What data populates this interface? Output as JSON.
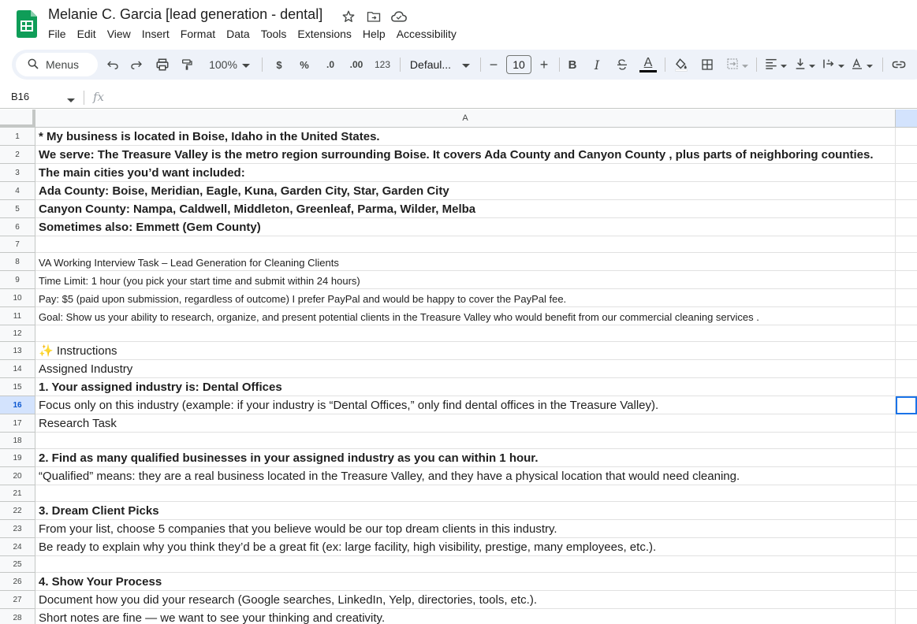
{
  "app": {
    "doc_title": "Melanie C. Garcia [lead generation - dental]",
    "menu": [
      "File",
      "Edit",
      "View",
      "Insert",
      "Format",
      "Data",
      "Tools",
      "Extensions",
      "Help",
      "Accessibility"
    ],
    "colors": {
      "sheets_green": "#0f9d58",
      "selection_blue": "#1a73e8",
      "header_sel": "#d3e3fd"
    }
  },
  "toolbar": {
    "search_label": "Menus",
    "zoom": "100%",
    "currency": "$",
    "percent": "%",
    "dec_decrease": ".0",
    "dec_increase": ".00",
    "number_format": "123",
    "font": "Defaul...",
    "font_size": "10",
    "minus": "−",
    "plus": "+",
    "bold": "B",
    "italic": "I",
    "text_color": "A"
  },
  "formula_bar": {
    "name_box": "B16",
    "fx": "fx"
  },
  "grid": {
    "column_header": "A",
    "rows": [
      {
        "n": "1",
        "text": "* My business is located in Boise, Idaho in the United States.",
        "style": "bold"
      },
      {
        "n": "2",
        "text": "We serve: The Treasure Valley is the metro region surrounding Boise. It covers Ada County and Canyon County , plus parts of neighboring counties.",
        "style": "bold"
      },
      {
        "n": "3",
        "text": "The main cities you’d want included:",
        "style": "bold"
      },
      {
        "n": "4",
        "text": "Ada County: Boise, Meridian, Eagle, Kuna, Garden City, Star, Garden City",
        "style": "bold"
      },
      {
        "n": "5",
        "text": "Canyon County: Nampa, Caldwell, Middleton, Greenleaf, Parma, Wilder, Melba",
        "style": "bold"
      },
      {
        "n": "6",
        "text": "Sometimes also: Emmett (Gem County)",
        "style": "bold"
      },
      {
        "n": "7",
        "text": "",
        "style": "short"
      },
      {
        "n": "8",
        "text": "VA Working Interview Task – Lead Generation for Cleaning Clients",
        "style": "small"
      },
      {
        "n": "9",
        "text": "Time Limit: 1 hour (you pick your start time and submit within 24 hours)",
        "style": "small"
      },
      {
        "n": "10",
        "text": "Pay: $5 (paid upon submission, regardless of outcome) I prefer PayPal and would be happy to cover the PayPal fee.",
        "style": "small"
      },
      {
        "n": "11",
        "text": "Goal: Show us your ability to research, organize, and present potential clients in the Treasure Valley who would benefit from our commercial cleaning services .",
        "style": "small"
      },
      {
        "n": "12",
        "text": "",
        "style": "short"
      },
      {
        "n": "13",
        "text": "✨ Instructions",
        "style": "normal"
      },
      {
        "n": "14",
        "text": "Assigned Industry",
        "style": "normal"
      },
      {
        "n": "15",
        "text": "1. Your assigned industry is: Dental Offices",
        "style": "bold"
      },
      {
        "n": "16",
        "text": "Focus only on this industry (example: if your industry is “Dental Offices,” only find dental offices in the Treasure Valley).",
        "style": "normal",
        "selected": true
      },
      {
        "n": "17",
        "text": "Research Task",
        "style": "normal"
      },
      {
        "n": "18",
        "text": "",
        "style": "short"
      },
      {
        "n": "19",
        "text": "2. Find as many qualified businesses in your assigned industry as you can within 1 hour.",
        "style": "bold"
      },
      {
        "n": "20",
        "text": "“Qualified” means: they are a real business located in the Treasure Valley, and they have a physical location that would need cleaning.",
        "style": "normal"
      },
      {
        "n": "21",
        "text": "",
        "style": "short"
      },
      {
        "n": "22",
        "text": "3. Dream Client Picks",
        "style": "bold"
      },
      {
        "n": "23",
        "text": "From your list, choose 5 companies that you believe would be our top dream clients in this industry.",
        "style": "normal"
      },
      {
        "n": "24",
        "text": "Be ready to explain why you think they’d be a great fit (ex: large facility, high visibility, prestige, many employees, etc.).",
        "style": "normal"
      },
      {
        "n": "25",
        "text": "",
        "style": "short"
      },
      {
        "n": "26",
        "text": "4. Show Your Process",
        "style": "bold"
      },
      {
        "n": "27",
        "text": "Document how you did your research (Google searches, LinkedIn, Yelp, directories, tools, etc.).",
        "style": "normal"
      },
      {
        "n": "28",
        "text": "Short notes are fine — we want to see your thinking and creativity.",
        "style": "normal"
      }
    ]
  }
}
